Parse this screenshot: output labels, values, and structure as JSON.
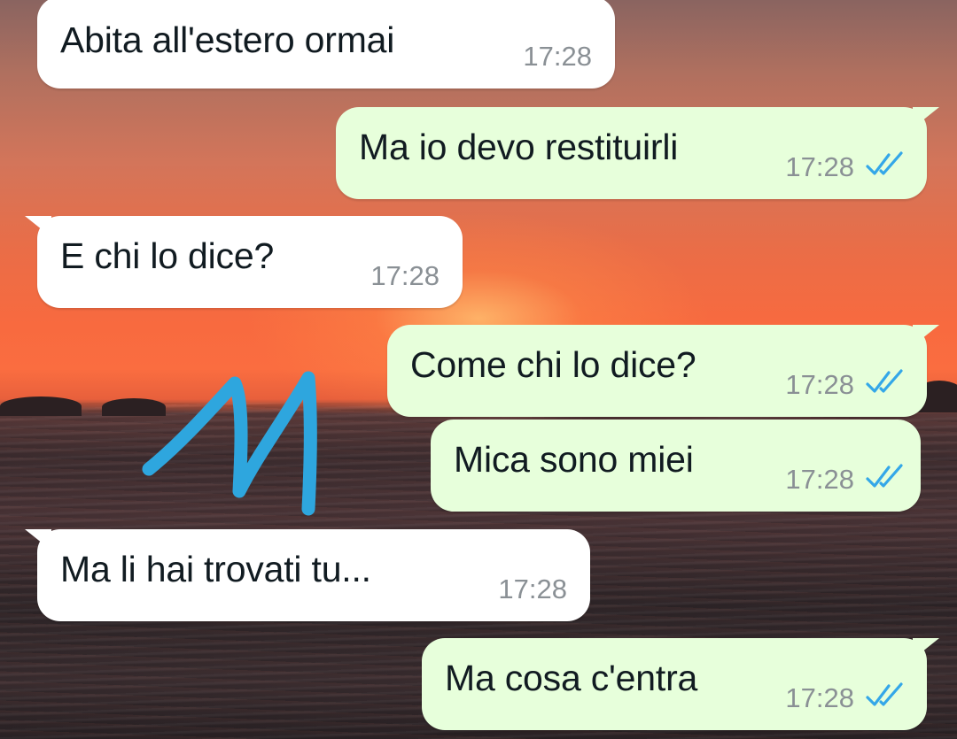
{
  "colors": {
    "incoming_bubble": "#ffffff",
    "outgoing_bubble": "#e7ffdb",
    "read_ticks": "#34a7e8",
    "annotation_stroke": "#2ea6de"
  },
  "messages": [
    {
      "direction": "incoming",
      "text": "Abita all'estero ormai",
      "time": "17:28"
    },
    {
      "direction": "outgoing",
      "text": "Ma io devo restituirli",
      "time": "17:28",
      "status": "read-ticks-icon"
    },
    {
      "direction": "incoming",
      "text": "E chi lo dice?",
      "time": "17:28"
    },
    {
      "direction": "outgoing",
      "text": "Come chi lo dice?",
      "time": "17:28",
      "status": "read-ticks-icon"
    },
    {
      "direction": "outgoing",
      "text": "Mica sono miei",
      "time": "17:28",
      "status": "read-ticks-icon"
    },
    {
      "direction": "incoming",
      "text": "Ma li hai trovati tu...",
      "time": "17:28"
    },
    {
      "direction": "outgoing",
      "text": "Ma cosa c'entra",
      "time": "17:28",
      "status": "read-ticks-icon"
    }
  ]
}
